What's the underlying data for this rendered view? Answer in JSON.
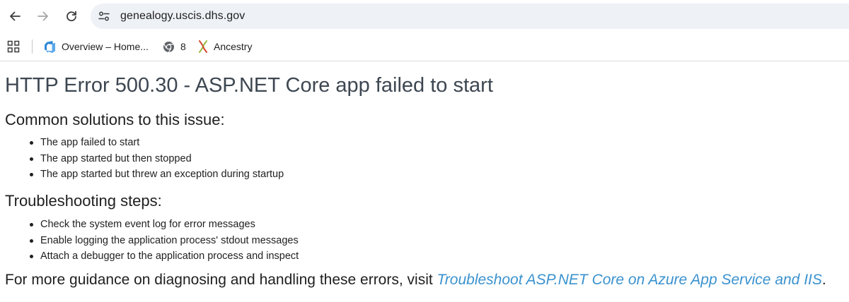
{
  "browser": {
    "url": "genealogy.uscis.dhs.gov",
    "nav": {
      "back_icon": "arrow-left-icon",
      "forward_icon": "arrow-right-icon",
      "reload_icon": "reload-icon",
      "site_info_icon": "tune-icon"
    },
    "bookmarks": [
      {
        "label": "Overview – Home...",
        "icon": "azure-devops-icon"
      },
      {
        "label": "8",
        "icon": "chrome-icon"
      },
      {
        "label": "Ancestry",
        "icon": "ancestry-leaf-icon"
      }
    ]
  },
  "page": {
    "title": "HTTP Error 500.30 - ASP.NET Core app failed to start",
    "solutions_heading": "Common solutions to this issue:",
    "solutions": [
      "The app failed to start",
      "The app started but then stopped",
      "The app started but threw an exception during startup"
    ],
    "troubleshooting_heading": "Troubleshooting steps:",
    "steps": [
      "Check the system event log for error messages",
      "Enable logging the application process' stdout messages",
      "Attach a debugger to the application process and inspect"
    ],
    "guidance_prefix": "For more guidance on diagnosing and handling these errors, visit ",
    "guidance_link": "Troubleshoot ASP.NET Core on Azure App Service and IIS",
    "guidance_suffix": ".",
    "link_color": "#3a92cf"
  }
}
